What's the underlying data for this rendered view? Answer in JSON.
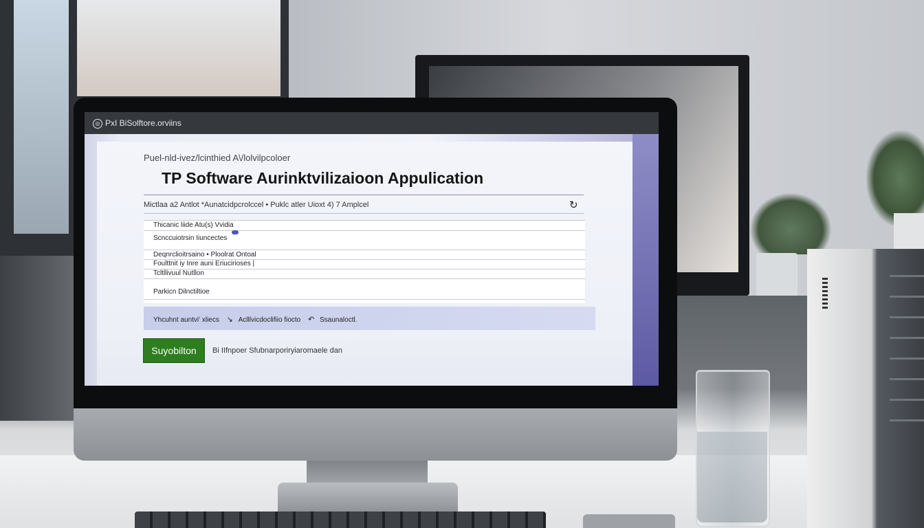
{
  "window": {
    "title": "PxI BiSolftore.orviins"
  },
  "page": {
    "subtitle": "Puel-nld-ivez/lcinthied A\\/lolvilpcoloer",
    "heading": "TP Software Aurinktvilizaioon Appulication",
    "meta_line": "Mictlaa a2 Antlot   *Aunatcidpcrolccel   • Puklc atler Uioxt   4) 7 Amplcel"
  },
  "form": {
    "fields": [
      {
        "label": "Thicanic liide Atu(s) Vvidia"
      },
      {
        "label": "Scnccuiotrsin    Iiuncectes"
      },
      {
        "label": "Deqnrclioitrsaino   • Ploolrat Ontoal"
      },
      {
        "label": "Foulttnit iy Inre auni Eriucirioses |"
      },
      {
        "label": "Tcltllivuul Nutllon"
      },
      {
        "label": "Parkicn Dilnctiltioe"
      }
    ]
  },
  "info_bar": {
    "segments": [
      "Yhcuhnt auntvi' xliecs",
      "Aclllvicdoclifiio fiocto",
      "Ssaunaloctl."
    ]
  },
  "actions": {
    "submit_label": "Suyobilton",
    "submit_note": "Bi  IIfnpoer Sfubnarporiryiaromaele dan"
  },
  "icons": {
    "title": "app-icon",
    "reload": "reload-icon",
    "arrow": "arrow-icon"
  },
  "colors": {
    "submit": "#2e7d1e",
    "info_bar": "#c7cdea",
    "titlebar": "#35383d"
  }
}
